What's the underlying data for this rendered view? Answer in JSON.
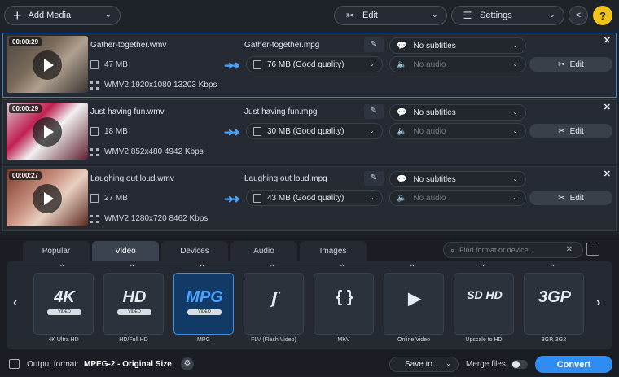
{
  "toolbar": {
    "add_media": "Add Media",
    "edit": "Edit",
    "settings": "Settings",
    "help": "?"
  },
  "files": [
    {
      "duration": "00:00:29",
      "name": "Gather-together.wmv",
      "size": "47 MB",
      "info": "WMV2 1920x1080 13203 Kbps",
      "output_name": "Gather-together.mpg",
      "output_size": "76 MB (Good quality)",
      "subtitles": "No subtitles",
      "audio": "No audio",
      "edit": "Edit",
      "selected": true
    },
    {
      "duration": "00:00:29",
      "name": "Just having fun.wmv",
      "size": "18 MB",
      "info": "WMV2 852x480 4942 Kbps",
      "output_name": "Just having fun.mpg",
      "output_size": "30 MB (Good quality)",
      "subtitles": "No subtitles",
      "audio": "No audio",
      "edit": "Edit",
      "selected": false
    },
    {
      "duration": "00:00:27",
      "name": "Laughing out loud.wmv",
      "size": "27 MB",
      "info": "WMV2 1280x720 8462 Kbps",
      "output_name": "Laughing out loud.mpg",
      "output_size": "43 MB (Good quality)",
      "subtitles": "No subtitles",
      "audio": "No audio",
      "edit": "Edit",
      "selected": false
    }
  ],
  "tabs": [
    "Popular",
    "Video",
    "Devices",
    "Audio",
    "Images"
  ],
  "active_tab": "Video",
  "search": {
    "placeholder": "Find format or device..."
  },
  "formats": [
    {
      "logo": "4K",
      "sub": "VIDEO",
      "label": "4K Ultra HD"
    },
    {
      "logo": "HD",
      "sub": "VIDEO",
      "label": "HD/Full HD"
    },
    {
      "logo": "MPG",
      "sub": "VIDEO",
      "label": "MPG",
      "active": true
    },
    {
      "logo": "f",
      "sub": "",
      "label": "FLV (Flash Video)"
    },
    {
      "logo": "{ }",
      "sub": "",
      "label": "MKV"
    },
    {
      "logo": "▶",
      "sub": "",
      "label": "Online Video"
    },
    {
      "logo": "SD HD",
      "sub": "",
      "label": "Upscale to HD"
    },
    {
      "logo": "3GP",
      "sub": "",
      "label": "3GP, 3G2"
    }
  ],
  "status": {
    "output_format_label": "Output format:",
    "output_format_value": "MPEG-2 - Original Size",
    "save_to": "Save to...",
    "merge_files": "Merge files:",
    "convert": "Convert"
  }
}
